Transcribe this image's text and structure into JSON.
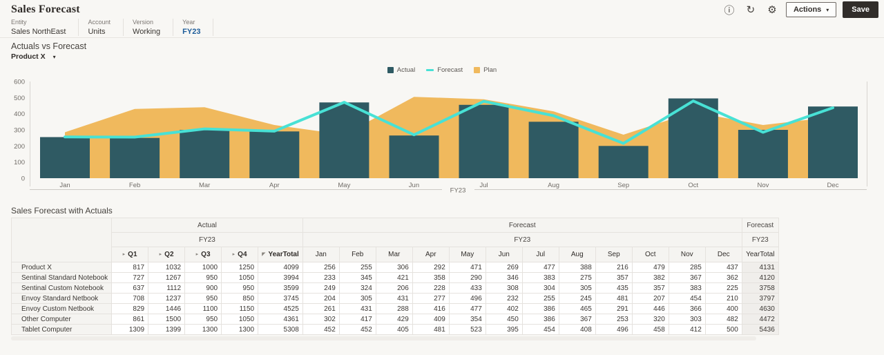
{
  "header": {
    "title": "Sales Forecast",
    "actions_label": "Actions",
    "save_label": "Save",
    "icons": {
      "info": "ⓘ",
      "refresh": "↻",
      "settings": "⚙",
      "caret_down": "▾"
    }
  },
  "pov": {
    "items": [
      {
        "label": "Entity",
        "value": "Sales NorthEast",
        "highlight": false
      },
      {
        "label": "Account",
        "value": "Units",
        "highlight": false
      },
      {
        "label": "Version",
        "value": "Working",
        "highlight": false
      },
      {
        "label": "Year",
        "value": "FY23",
        "highlight": true
      }
    ]
  },
  "chart": {
    "title": "Actuals vs Forecast",
    "member_selector": "Product X"
  },
  "chart_data": {
    "type": "combo",
    "title": "Actuals vs Forecast",
    "categories": [
      "Jan",
      "Feb",
      "Mar",
      "Apr",
      "May",
      "Jun",
      "Jul",
      "Aug",
      "Sep",
      "Oct",
      "Nov",
      "Dec"
    ],
    "series": [
      {
        "name": "Actual",
        "type": "bar",
        "color": "#2F5A63",
        "values": [
          255,
          250,
          300,
          290,
          470,
          265,
          455,
          350,
          200,
          495,
          300,
          445
        ]
      },
      {
        "name": "Forecast",
        "type": "line",
        "color": "#48E1D5",
        "values": [
          256,
          255,
          306,
          292,
          471,
          269,
          477,
          388,
          216,
          479,
          285,
          437
        ]
      },
      {
        "name": "Plan",
        "type": "area",
        "color": "#F0B95D",
        "values": [
          285,
          430,
          440,
          330,
          270,
          505,
          490,
          415,
          270,
          410,
          330,
          380
        ]
      }
    ],
    "xlabel": "FY23",
    "ylabel": "",
    "ylim": [
      0,
      600
    ],
    "yticks": [
      0,
      100,
      200,
      300,
      400,
      500,
      600
    ],
    "grid": false,
    "legend_position": "top"
  },
  "table": {
    "title": "Sales Forecast with Actuals",
    "column_groups": [
      {
        "label": "Actual",
        "year": "FY23",
        "columns": [
          {
            "label": "Q1",
            "icon": "▸",
            "bold": true
          },
          {
            "label": "Q2",
            "icon": "▸",
            "bold": true
          },
          {
            "label": "Q3",
            "icon": "▸",
            "bold": true
          },
          {
            "label": "Q4",
            "icon": "▸",
            "bold": true
          },
          {
            "label": "YearTotal",
            "icon": "◤",
            "bold": true
          }
        ]
      },
      {
        "label": "Forecast",
        "year": "FY23",
        "columns": [
          {
            "label": "Jan"
          },
          {
            "label": "Feb"
          },
          {
            "label": "Mar"
          },
          {
            "label": "Apr"
          },
          {
            "label": "May"
          },
          {
            "label": "Jun"
          },
          {
            "label": "Jul"
          },
          {
            "label": "Aug"
          },
          {
            "label": "Sep"
          },
          {
            "label": "Oct"
          },
          {
            "label": "Nov"
          },
          {
            "label": "Dec"
          }
        ]
      },
      {
        "label": "Forecast",
        "year": "FY23",
        "columns": [
          {
            "label": "YearTotal"
          }
        ]
      }
    ],
    "rows": [
      {
        "name": "Product X",
        "actual": [
          817,
          1032,
          1000,
          1250,
          4099
        ],
        "forecast": [
          256,
          255,
          306,
          292,
          471,
          269,
          477,
          388,
          216,
          479,
          285,
          437
        ],
        "total": 4131
      },
      {
        "name": "Sentinal Standard Notebook",
        "actual": [
          727,
          1267,
          950,
          1050,
          3994
        ],
        "forecast": [
          233,
          345,
          421,
          358,
          290,
          346,
          383,
          275,
          357,
          382,
          367,
          362
        ],
        "total": 4120
      },
      {
        "name": "Sentinal Custom Notebook",
        "actual": [
          637,
          1112,
          900,
          950,
          3599
        ],
        "forecast": [
          249,
          324,
          206,
          228,
          433,
          308,
          304,
          305,
          435,
          357,
          383,
          225
        ],
        "total": 3758
      },
      {
        "name": "Envoy Standard Netbook",
        "actual": [
          708,
          1237,
          950,
          850,
          3745
        ],
        "forecast": [
          204,
          305,
          431,
          277,
          496,
          232,
          255,
          245,
          481,
          207,
          454,
          210
        ],
        "total": 3797
      },
      {
        "name": "Envoy Custom Netbook",
        "actual": [
          829,
          1446,
          1100,
          1150,
          4525
        ],
        "forecast": [
          261,
          431,
          288,
          416,
          477,
          402,
          386,
          465,
          291,
          446,
          366,
          400
        ],
        "total": 4630
      },
      {
        "name": "Other Computer",
        "actual": [
          861,
          1500,
          950,
          1050,
          4361
        ],
        "forecast": [
          302,
          417,
          429,
          409,
          354,
          450,
          386,
          367,
          253,
          320,
          303,
          482
        ],
        "total": 4472
      },
      {
        "name": "Tablet Computer",
        "actual": [
          1309,
          1399,
          1300,
          1300,
          5308
        ],
        "forecast": [
          452,
          452,
          405,
          481,
          523,
          395,
          454,
          408,
          496,
          458,
          412,
          500
        ],
        "total": 5436
      }
    ]
  }
}
